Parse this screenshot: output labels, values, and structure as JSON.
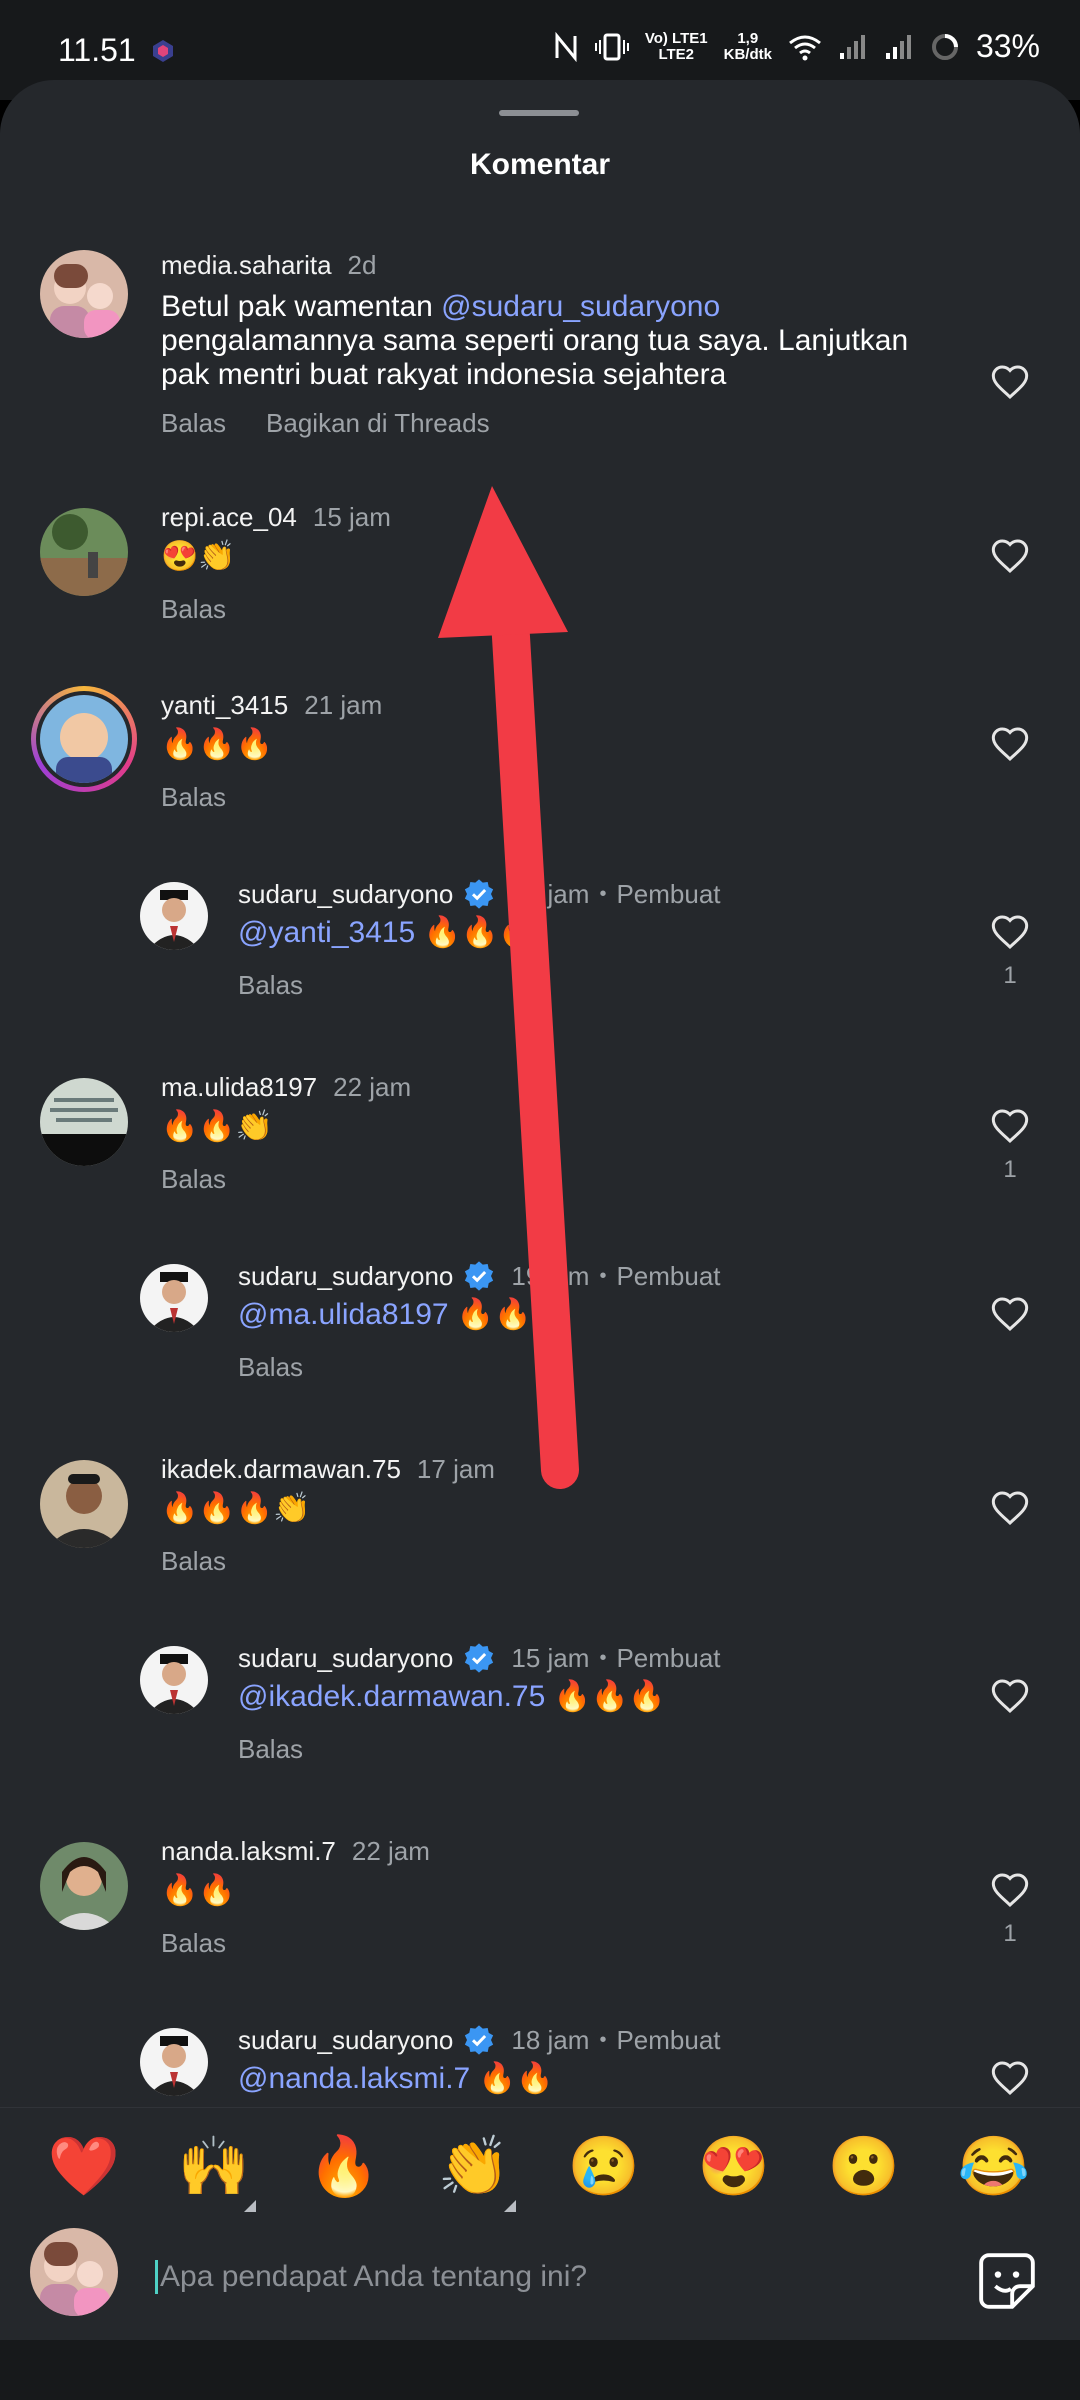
{
  "status_bar": {
    "time": "11.51",
    "network_label_top": "Vo) LTE1",
    "network_label_bottom": "LTE2",
    "speed_top": "1,9",
    "speed_bottom": "KB/dtk",
    "battery": "33%"
  },
  "sheet": {
    "title": "Komentar"
  },
  "comments": [
    {
      "username": "media.saharita",
      "time": "2d",
      "text_before": "Betul pak wamentan ",
      "mention": "@sudaru_sudaryono",
      "text_line2": "pengalamannya sama seperti orang tua saya. Lanjutkan",
      "text_line3": "pak mentri buat rakyat indonesia sejahtera",
      "reply": "Balas",
      "share": "Bagikan di Threads"
    },
    {
      "username": "repi.ace_04",
      "time": "15 jam",
      "text": "😍👏",
      "reply": "Balas"
    },
    {
      "username": "yanti_3415",
      "time": "21 jam",
      "text": "🔥🔥🔥",
      "reply": "Balas"
    },
    {
      "username": "sudaru_sudaryono",
      "time": "18 jam",
      "creator": "Pembuat",
      "mention": "@yanti_3415",
      "text": " 🔥🔥🔥",
      "reply": "Balas",
      "likes": "1"
    },
    {
      "username": "ma.ulida8197",
      "time": "22 jam",
      "text": "🔥🔥👏",
      "reply": "Balas",
      "likes": "1"
    },
    {
      "username": "sudaru_sudaryono",
      "time": "19 jam",
      "creator": "Pembuat",
      "mention": "@ma.ulida8197",
      "text": " 🔥🔥👏",
      "reply": "Balas"
    },
    {
      "username": "ikadek.darmawan.75",
      "time": "17 jam",
      "text": "🔥🔥🔥👏",
      "reply": "Balas"
    },
    {
      "username": "sudaru_sudaryono",
      "time": "15 jam",
      "creator": "Pembuat",
      "mention": "@ikadek.darmawan.75",
      "text": " 🔥🔥🔥",
      "reply": "Balas"
    },
    {
      "username": "nanda.laksmi.7",
      "time": "22 jam",
      "text": "🔥🔥",
      "reply": "Balas",
      "likes": "1"
    },
    {
      "username": "sudaru_sudaryono",
      "time": "18 jam",
      "creator": "Pembuat",
      "mention": "@nanda.laksmi.7",
      "text": " 🔥🔥"
    }
  ],
  "reactions": [
    "❤️",
    "🙌",
    "🔥",
    "👏",
    "😢",
    "😍",
    "😮",
    "😂"
  ],
  "composer": {
    "placeholder": "Apa pendapat Anda tentang ini?"
  },
  "icons": {
    "like": "heart-outline-icon",
    "verified": "verified-badge-icon",
    "sticker": "sticker-icon"
  },
  "colors": {
    "mention": "#8aa4ff",
    "background": "#25282c",
    "arrow": "#f23b45"
  }
}
